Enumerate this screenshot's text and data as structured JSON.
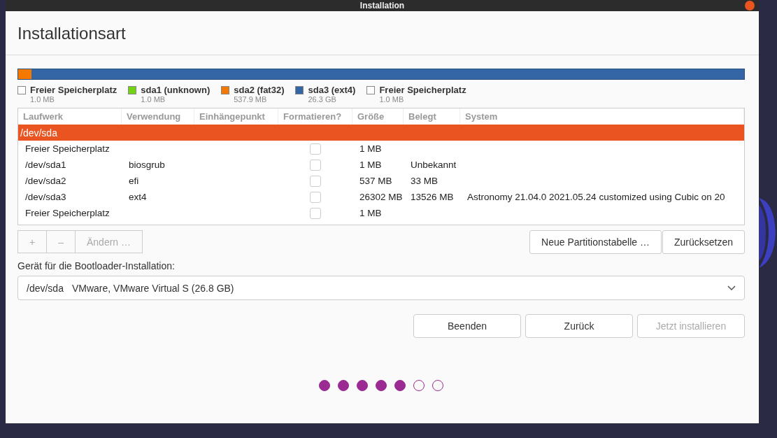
{
  "window": {
    "title": "Installation"
  },
  "heading": "Installationsart",
  "partitions": [
    {
      "name": "Freier Speicherplatz",
      "size": "1.0 MB",
      "color": "#ffffff",
      "level": 0
    },
    {
      "name": "sda1 (unknown)",
      "size": "1.0 MB",
      "color": "#73d216",
      "level": 0
    },
    {
      "name": "sda2 (fat32)",
      "size": "537.9 MB",
      "color": "#f57900",
      "level": 0.018
    },
    {
      "name": "sda3 (ext4)",
      "size": "26.3 GB",
      "color": "#3465a4",
      "level": 0.982
    },
    {
      "name": "Freier Speicherplatz",
      "size": "1.0 MB",
      "color": "#ffffff",
      "level": 0
    }
  ],
  "table": {
    "columns": [
      "Laufwerk",
      "Verwendung",
      "Einhängepunkt",
      "Formatieren?",
      "Größe",
      "Belegt",
      "System"
    ],
    "rows": [
      {
        "kind": "disk",
        "selected": true,
        "cells": [
          "/dev/sda"
        ]
      },
      {
        "kind": "partition",
        "selected": false,
        "checked": false,
        "cells": [
          "Freier Speicherplatz",
          "",
          "",
          "",
          "1 MB",
          "",
          ""
        ]
      },
      {
        "kind": "partition",
        "selected": false,
        "checked": false,
        "cells": [
          "/dev/sda1",
          "biosgrub",
          "",
          "",
          "1 MB",
          "Unbekannt",
          ""
        ]
      },
      {
        "kind": "partition",
        "selected": false,
        "checked": false,
        "cells": [
          "/dev/sda2",
          "efi",
          "",
          "",
          "537 MB",
          "33 MB",
          ""
        ]
      },
      {
        "kind": "partition",
        "selected": false,
        "checked": false,
        "cells": [
          "/dev/sda3",
          "ext4",
          "",
          "",
          "26302 MB",
          "13526 MB",
          "Astronomy 21.04.0 2021.05.24 customized using Cubic on 20"
        ]
      },
      {
        "kind": "partition",
        "selected": false,
        "checked": false,
        "cells": [
          "Freier Speicherplatz",
          "",
          "",
          "",
          "1 MB",
          "",
          ""
        ]
      }
    ]
  },
  "table_buttons": [
    {
      "label": "+",
      "disabled": true
    },
    {
      "label": "–",
      "disabled": true
    },
    {
      "label": "Ändern …",
      "disabled": true
    }
  ],
  "table_actions": [
    {
      "label": "Neue Partitionstabelle …",
      "disabled": false
    },
    {
      "label": "Zurücksetzen",
      "disabled": false
    }
  ],
  "bootloader": {
    "label": "Gerät für die Bootloader-Installation:",
    "device": "/dev/sda",
    "description": "VMware, VMware Virtual S (26.8 GB)"
  },
  "buttons": [
    {
      "label": "Beenden",
      "disabled": false
    },
    {
      "label": "Zurück",
      "disabled": false
    },
    {
      "label": "Jetzt installieren",
      "disabled": true
    }
  ],
  "steps": [
    {
      "done": true
    },
    {
      "done": true
    },
    {
      "done": true
    },
    {
      "done": true
    },
    {
      "done": true
    },
    {
      "done": false
    },
    {
      "done": false
    }
  ]
}
